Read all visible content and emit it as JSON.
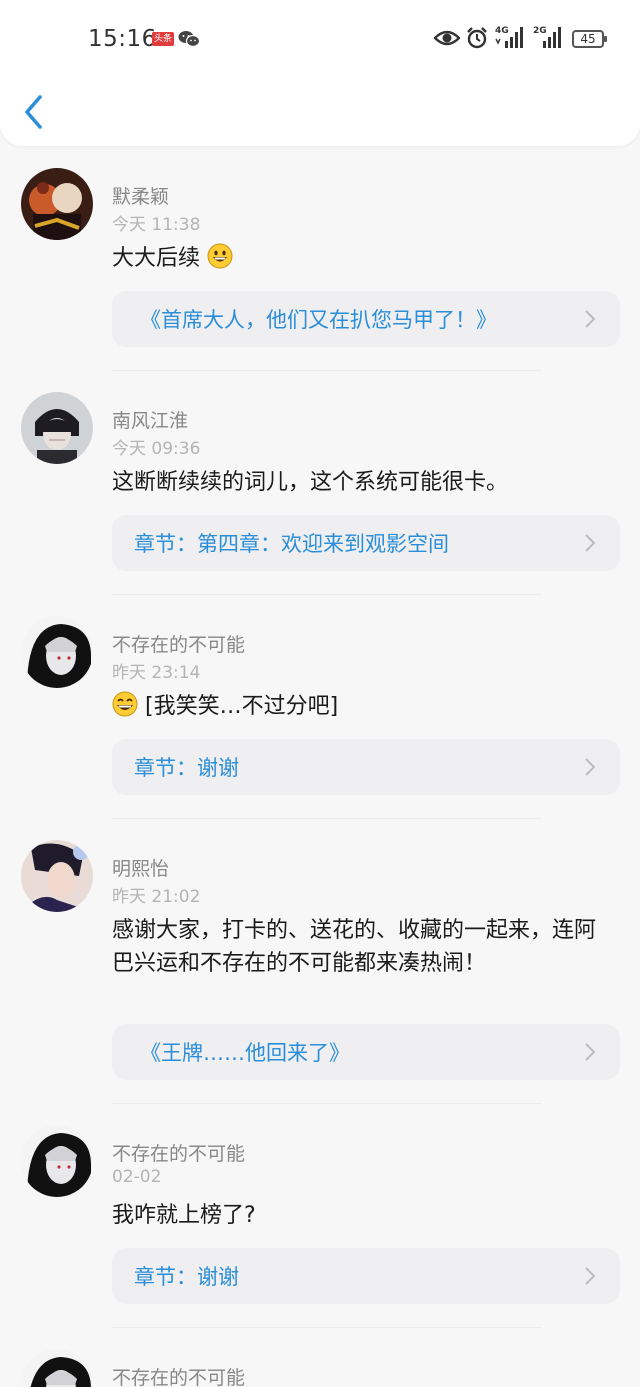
{
  "status_bar": {
    "time": "15:16",
    "toutiao_badge": "头条",
    "network1": "4G",
    "network2": "2G",
    "battery": "45"
  },
  "comments": [
    {
      "name": "默柔颖",
      "date": "今天 11:38",
      "text": "大大后续",
      "emoji": "grin-emoji",
      "ref": "《首席大人，他们又在扒您马甲了！》",
      "ref_type": "book"
    },
    {
      "name": "南风江淮",
      "date": "今天 09:36",
      "text": "这断断续续的词儿，这个系统可能很卡。",
      "ref": "章节：第四章：欢迎来到观影空间",
      "ref_type": "chapter"
    },
    {
      "name": "不存在的不可能",
      "date": "昨天 23:14",
      "text": "[我笑笑…不过分吧]",
      "emoji_prefix": "laugh-emoji",
      "ref": "章节：谢谢",
      "ref_type": "chapter"
    },
    {
      "name": "明熙怡",
      "date": "昨天 21:02",
      "text": "感谢大家，打卡的、送花的、收藏的一起来，连阿巴兴运和不存在的不可能都来凑热闹！",
      "ref": "《王牌……他回来了》",
      "ref_type": "book"
    },
    {
      "name": "不存在的不可能",
      "date": "02-02",
      "text": "我咋就上榜了?",
      "ref": "章节：谢谢",
      "ref_type": "chapter"
    },
    {
      "name": "不存在的不可能"
    }
  ],
  "colors": {
    "accent": "#2a8ed8",
    "name_gray": "#888888",
    "date_gray": "#b4b4b4",
    "ref_bg": "#efeff1"
  }
}
